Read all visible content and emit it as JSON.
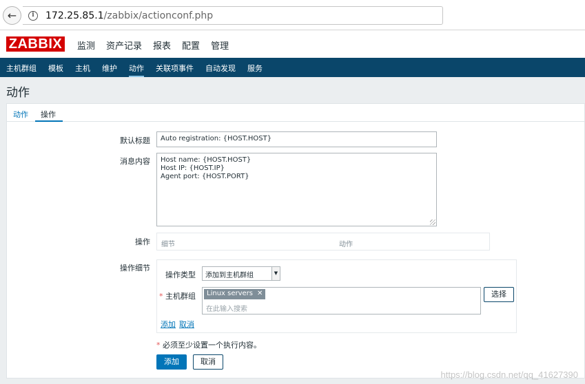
{
  "browser": {
    "url_host": "172.25.85.1",
    "url_path": "/zabbix/actionconf.php"
  },
  "header": {
    "logo": "ZABBIX",
    "menu": [
      "监测",
      "资产记录",
      "报表",
      "配置",
      "管理"
    ]
  },
  "subnav": {
    "items": [
      "主机群组",
      "模板",
      "主机",
      "维护",
      "动作",
      "关联项事件",
      "自动发现",
      "服务"
    ],
    "active": "动作"
  },
  "page": {
    "title": "动作"
  },
  "tabs": {
    "action": "动作",
    "operations": "操作"
  },
  "form": {
    "default_subject_label": "默认标题",
    "default_subject_value": "Auto registration: {HOST.HOST}",
    "message_label": "消息内容",
    "message_value": "Host name: {HOST.HOST}\nHost IP: {HOST.IP}\nAgent port: {HOST.PORT}",
    "operations_label": "操作",
    "operations_col_details": "细节",
    "operations_col_action": "动作",
    "op_details_label": "操作细节",
    "op_type_label": "操作类型",
    "op_type_value": "添加到主机群组",
    "host_group_label": "主机群组",
    "host_group_chip": "Linux servers",
    "host_group_placeholder": "在此输入搜索",
    "select_button": "选择",
    "add_link": "添加",
    "cancel_link": "取消",
    "required_note": "必须至少设置一个执行内容。",
    "add_button": "添加",
    "cancel_button": "取消"
  },
  "watermark": "https://blog.csdn.net/qq_41627390"
}
